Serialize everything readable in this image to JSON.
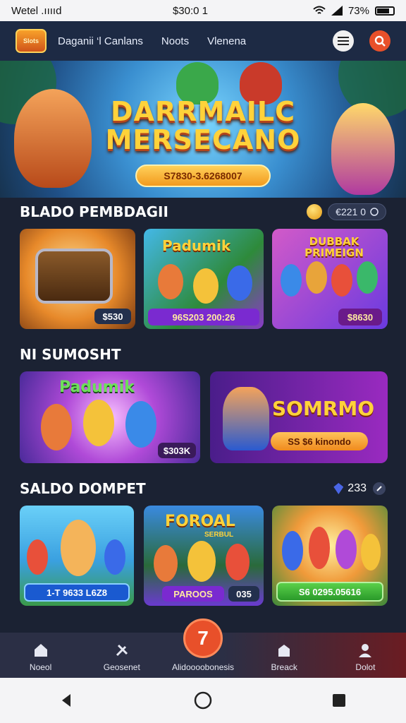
{
  "status_bar": {
    "carrier": "Wetel .ııııd",
    "time": "$30:0 1",
    "battery": "73%"
  },
  "nav": {
    "logo": "Slots",
    "links": [
      "Daganii ‘l Canlans",
      "Noots",
      "Vlenena"
    ]
  },
  "hero": {
    "title_line1": "DARRMAILC",
    "title_line2": "MERSECANO",
    "cta": "S7830-3.6268007"
  },
  "section1": {
    "title": "BLADO PEMBDAGII",
    "counter": "€221 0",
    "cards": [
      {
        "art_title": "",
        "price": "$530"
      },
      {
        "art_title": "Padumik",
        "price": "96S203 200:26"
      },
      {
        "art_title": "DUBBAK PRIMEIGN",
        "price": "$8630"
      }
    ]
  },
  "section2": {
    "title": "NI SUMOSHT",
    "cards": [
      {
        "art_title": "Padumik",
        "price": "$303K"
      },
      {
        "art_title": "SOMRMO",
        "button": "SS $6 kinondo"
      }
    ]
  },
  "section3": {
    "title": "SALDO DOMPET",
    "counter": "233",
    "cards": [
      {
        "art_title": "",
        "price": "1-T 9633 L6Z8"
      },
      {
        "art_title": "FOROAL",
        "subtitle": "SERBUL",
        "label": "PAROOS",
        "price": "035"
      },
      {
        "art_title": "",
        "price": "S6 0295.05616"
      }
    ]
  },
  "bottom_nav": {
    "items": [
      {
        "label": "Noeol",
        "icon": "home-icon"
      },
      {
        "label": "Geosenet",
        "icon": "tools-icon"
      },
      {
        "label": "Alidoooobonesis",
        "icon": "wallet-icon"
      },
      {
        "label": "Breack",
        "icon": "shop-icon"
      },
      {
        "label": "Dolot",
        "icon": "profile-icon"
      }
    ],
    "badge": "7"
  },
  "colors": {
    "accent": "#e8502a",
    "nav_bg": "#1d2a44",
    "page_bg": "#1b2233",
    "gold": "#ffd23a"
  }
}
